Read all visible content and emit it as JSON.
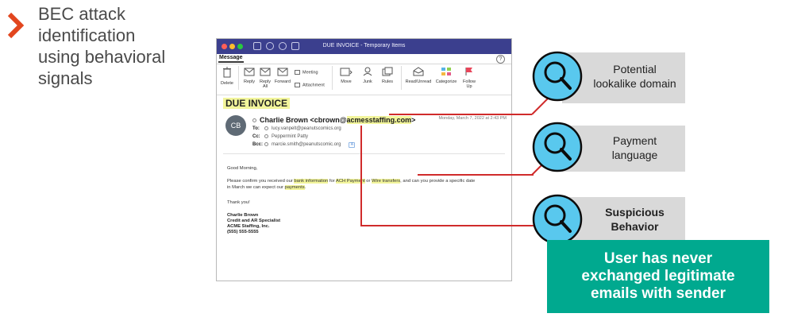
{
  "heading": {
    "chevron_color": "#e2461e",
    "lines": [
      "BEC attack",
      "identification",
      "using behavioral",
      "signals"
    ]
  },
  "mail_window": {
    "title": "DUE INVOICE - Temporary Items",
    "ribbon_tab": "Message",
    "help": "?",
    "ribbon": {
      "delete": "Delete",
      "reply": "Reply",
      "reply_all_1": "Reply",
      "reply_all_2": "All",
      "forward": "Forward",
      "meeting": "Meeting",
      "attachment": "Attachment",
      "move": "Move",
      "junk": "Junk",
      "rules": "Rules",
      "read_unread": "Read/Unread",
      "categorize": "Categorize",
      "follow_up_1": "Follow",
      "follow_up_2": "Up"
    },
    "subject": "DUE INVOICE",
    "avatar_initials": "CB",
    "from_name": "Charlie Brown <cbrown@",
    "from_domain": "acmesstaffing.com",
    "from_end": ">",
    "date": "Monday, March 7, 2022 at 2:43 PM",
    "to_label": "To:",
    "to_value": "lucy.vanpelt@peanutscomics.org",
    "cc_label": "Cc:",
    "cc_value": "Peppermint Patty",
    "bcc_label": "Bcc:",
    "bcc_value": "marcie.smith@peanutscomic.org",
    "greeting": "Good Morning,",
    "body": {
      "p1": "Please confirm you received our ",
      "h1": "bank information",
      "p2": " for ",
      "h2": "ACH Payment",
      "p3": " or ",
      "h3": "Wire transfers",
      "p4": ", and can you provide a specific date",
      "p5": "in March we can expect our ",
      "h4": "payments",
      "p6": "."
    },
    "thanks": "Thank you!",
    "signature": [
      "Charlie Brown",
      "Credit and AR Specialist",
      "ACME Staffing, Inc.",
      "(555) 555-5555"
    ]
  },
  "callouts": {
    "lookalike": [
      "Potential",
      "lookalike domain"
    ],
    "payment": [
      "Payment",
      "language"
    ],
    "behavior": [
      "Suspicious",
      "Behavior"
    ]
  },
  "alert_lines": [
    "User has never",
    "exchanged legitimate",
    "emails with sender"
  ],
  "colors": {
    "connector": "#d02b2b",
    "highlight": "#f2f59b",
    "alert": "#00a98f",
    "magnifier_fill": "#59c8ee",
    "callout_bg": "#d9d9d9"
  }
}
